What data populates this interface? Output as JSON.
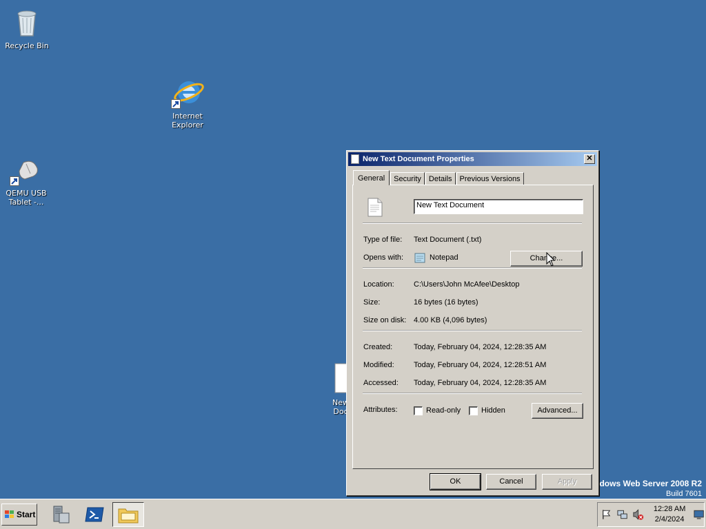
{
  "desktop": {
    "icons": [
      {
        "label": "Recycle Bin"
      },
      {
        "label": "Internet Explorer"
      },
      {
        "label": "QEMU USB Tablet -..."
      },
      {
        "label": "New Text Document",
        "label_visible": "New\nDoc"
      }
    ],
    "watermark": {
      "line1": "ndows Web Server 2008 R2",
      "line2": "Build 7601"
    }
  },
  "dialog": {
    "title": "New Text Document Properties",
    "close_label": "✕",
    "tabs": [
      {
        "label": "General",
        "active": true
      },
      {
        "label": "Security"
      },
      {
        "label": "Details"
      },
      {
        "label": "Previous Versions"
      }
    ],
    "file_name": "New Text Document",
    "type_label": "Type of file:",
    "type_value": "Text Document (.txt)",
    "opens_label": "Opens with:",
    "opens_value": "Notepad",
    "change_button": "Change...",
    "location_label": "Location:",
    "location_value": "C:\\Users\\John McAfee\\Desktop",
    "size_label": "Size:",
    "size_value": "16 bytes (16 bytes)",
    "size_disk_label": "Size on disk:",
    "size_disk_value": "4.00 KB (4,096 bytes)",
    "created_label": "Created:",
    "created_value": "Today, February 04, 2024, 12:28:35 AM",
    "modified_label": "Modified:",
    "modified_value": "Today, February 04, 2024, 12:28:51 AM",
    "accessed_label": "Accessed:",
    "accessed_value": "Today, February 04, 2024, 12:28:35 AM",
    "attributes_label": "Attributes:",
    "readonly_label": "Read-only",
    "hidden_label": "Hidden",
    "advanced_button": "Advanced...",
    "ok_button": "OK",
    "cancel_button": "Cancel",
    "apply_button": "Apply"
  },
  "taskbar": {
    "start_label": "Start",
    "clock_time": "12:28 AM",
    "clock_date": "2/4/2024"
  },
  "colors": {
    "desktop": "#3a6ea5",
    "titlebar_start": "#0a246a",
    "titlebar_end": "#a6caf0",
    "face": "#d4d0c8"
  }
}
